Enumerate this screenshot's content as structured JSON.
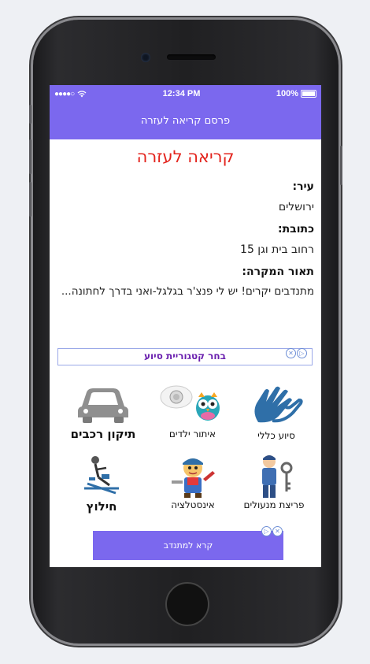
{
  "status": {
    "carrier_dots": "●●●●○",
    "time": "12:34 PM",
    "battery": "100%"
  },
  "navbar": {
    "title": "פרסם קריאה לעזרה"
  },
  "page": {
    "heading": "קריאה לעזרה",
    "city_label": "עיר:",
    "city_value": "ירושלים",
    "address_label": "כתובת:",
    "address_value": "רחוב בית וגן 15",
    "description_label": "תאור המקרה:",
    "description_value": "מתנדבים יקרים! יש לי פנצ'ר בגלגל-ואני בדרך לחתונה..."
  },
  "category": {
    "prompt": "בחר קטגוריית סיוע"
  },
  "tiles": [
    {
      "label": "תיקון רכבים",
      "icon": "car-icon"
    },
    {
      "label": "איתור ילדים",
      "icon": "owl-icon"
    },
    {
      "label": "סיוע כללי",
      "icon": "helping-hands-icon"
    },
    {
      "label": "חילוץ",
      "icon": "rescue-icon"
    },
    {
      "label": "אינסטלציה",
      "icon": "plumber-icon"
    },
    {
      "label": "פריצת מנעולים",
      "icon": "locksmith-icon"
    }
  ],
  "cta": {
    "label": "קרא למתנדב"
  },
  "colors": {
    "accent": "#7b68ee",
    "heading": "#e3231c",
    "category_text": "#6a1fae"
  }
}
